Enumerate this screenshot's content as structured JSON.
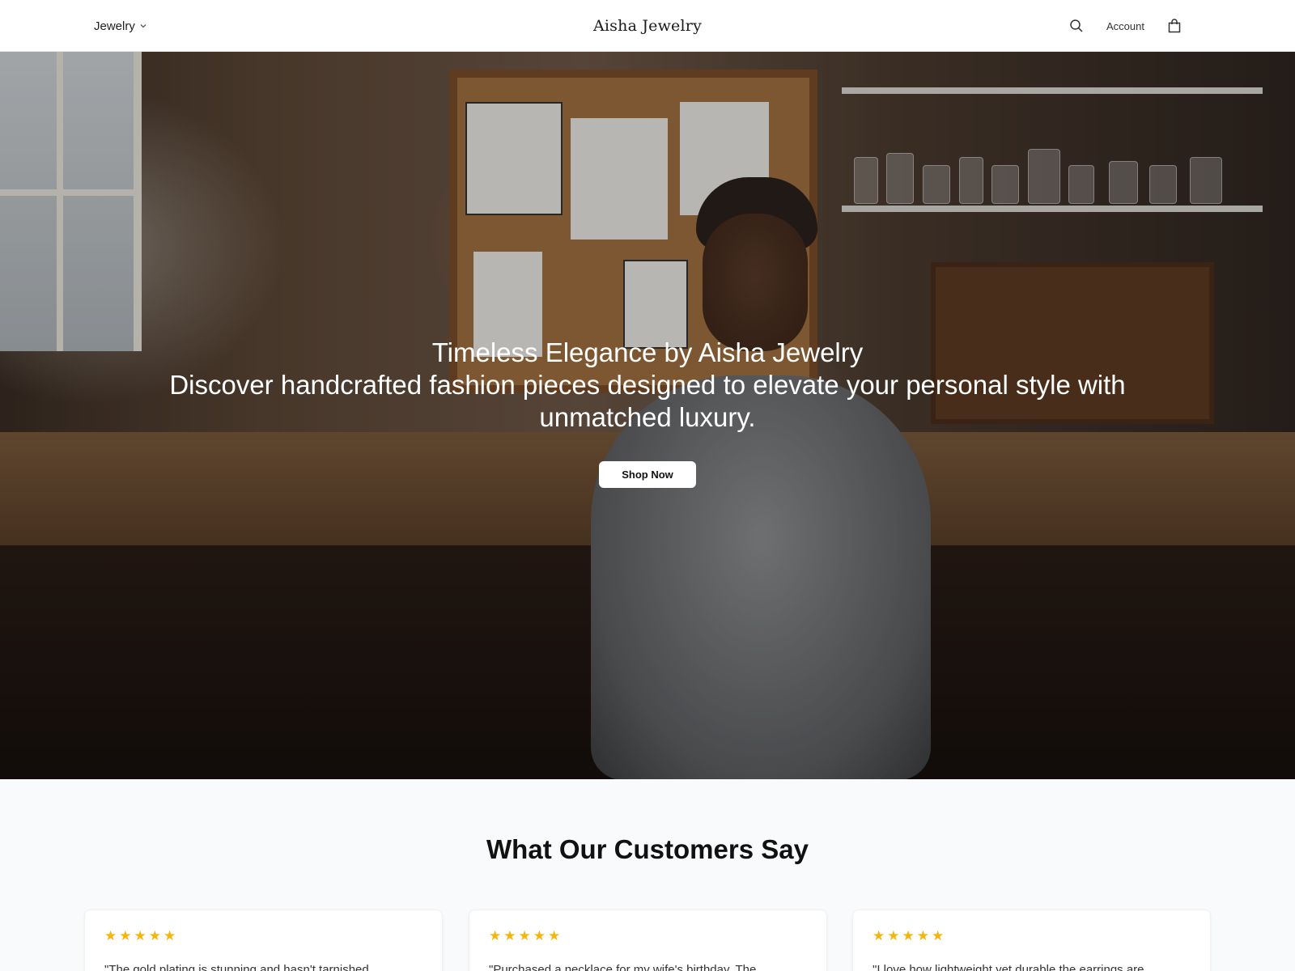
{
  "header": {
    "menu_label": "Jewelry",
    "brand": "Aisha Jewelry",
    "account_label": "Account"
  },
  "hero": {
    "title": "Timeless Elegance by Aisha Jewelry",
    "subtitle": "Discover handcrafted fashion pieces designed to elevate your personal style with unmatched luxury.",
    "cta_label": "Shop Now"
  },
  "reviews": {
    "title": "What Our Customers Say",
    "items": [
      {
        "stars": "★★★★★",
        "quote": "\"The gold plating is stunning and hasn't tarnished"
      },
      {
        "stars": "★★★★★",
        "quote": "\"Purchased a necklace for my wife's birthday. The"
      },
      {
        "stars": "★★★★★",
        "quote": "\"I love how lightweight yet durable the earrings are"
      }
    ]
  },
  "colors": {
    "star": "#f5b50a",
    "button_bg": "#ffffff",
    "page_bg": "#f9fafb"
  }
}
